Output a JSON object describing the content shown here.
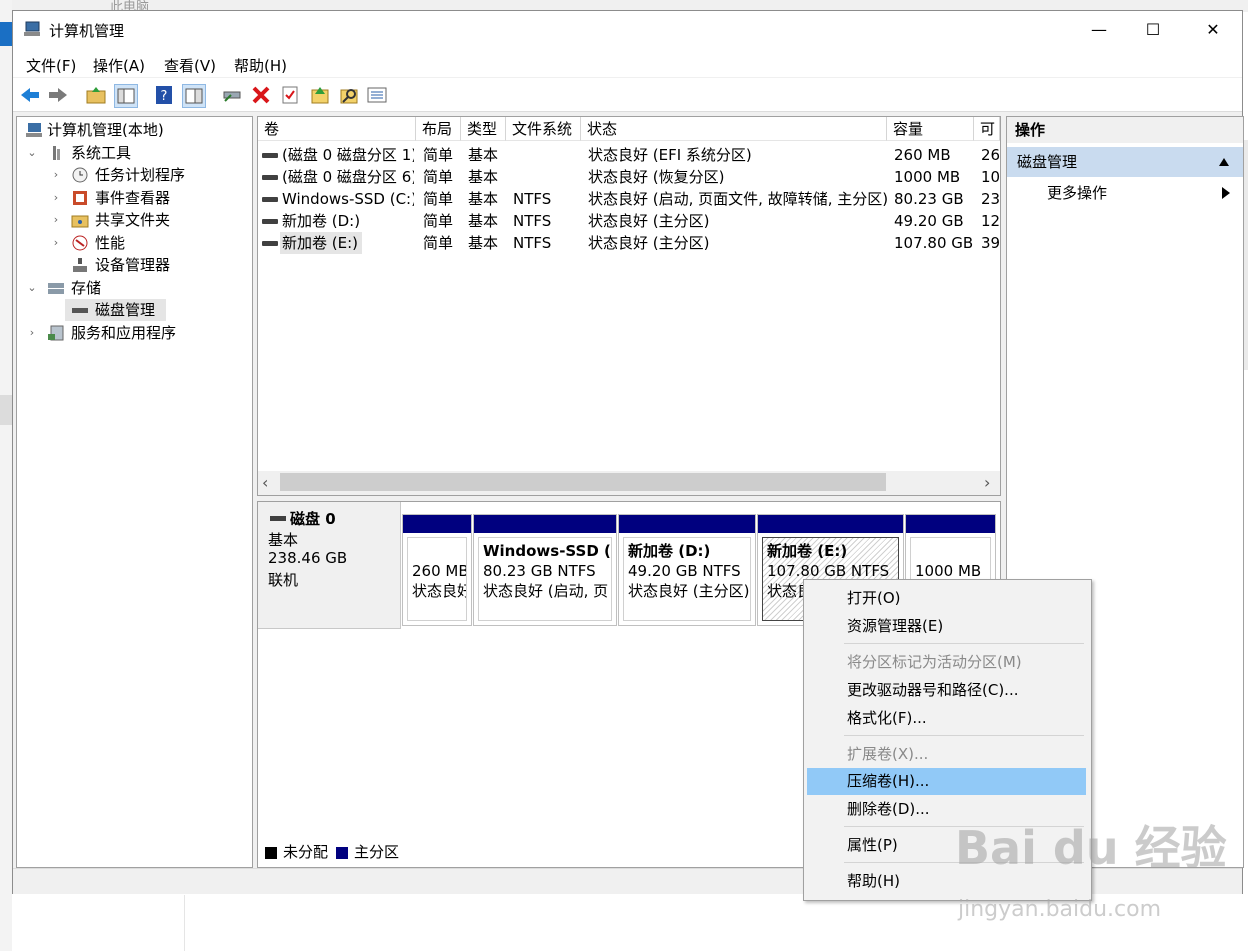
{
  "bg_tab_label": "此电脑",
  "window": {
    "title": "计算机管理",
    "minimize": "—",
    "maximize": "☐",
    "close": "✕"
  },
  "menu": [
    "文件(F)",
    "操作(A)",
    "查看(V)",
    "帮助(H)"
  ],
  "toolbar_icons": [
    "back-icon",
    "forward-icon",
    "up-folder-icon",
    "show-hide-tree-icon",
    "help-icon",
    "properties-view-icon",
    "connect-icon",
    "delete-icon",
    "check-icon",
    "import-icon",
    "search-icon",
    "list-icon"
  ],
  "tree": {
    "root": "计算机管理(本地)",
    "system_tools": "系统工具",
    "task_scheduler": "任务计划程序",
    "event_viewer": "事件查看器",
    "shared_folders": "共享文件夹",
    "performance": "性能",
    "device_manager": "设备管理器",
    "storage": "存储",
    "disk_management": "磁盘管理",
    "services": "服务和应用程序"
  },
  "volumes": {
    "columns": [
      "卷",
      "布局",
      "类型",
      "文件系统",
      "状态",
      "容量",
      "可"
    ],
    "rows": [
      [
        "(磁盘 0 磁盘分区 1)",
        "简单",
        "基本",
        "",
        "状态良好 (EFI 系统分区)",
        "260 MB",
        "26"
      ],
      [
        "(磁盘 0 磁盘分区 6)",
        "简单",
        "基本",
        "",
        "状态良好 (恢复分区)",
        "1000 MB",
        "10"
      ],
      [
        "Windows-SSD (C:)",
        "简单",
        "基本",
        "NTFS",
        "状态良好 (启动, 页面文件, 故障转储, 主分区)",
        "80.23 GB",
        "23"
      ],
      [
        "新加卷 (D:)",
        "简单",
        "基本",
        "NTFS",
        "状态良好 (主分区)",
        "49.20 GB",
        "12"
      ],
      [
        "新加卷 (E:)",
        "简单",
        "基本",
        "NTFS",
        "状态良好 (主分区)",
        "107.80 GB",
        "39"
      ]
    ],
    "scroll_left": "‹",
    "scroll_right": "›"
  },
  "disk": {
    "name": "磁盘 0",
    "type": "基本",
    "size": "238.46 GB",
    "status": "联机",
    "partitions": [
      {
        "title": "",
        "line1": "260 MB",
        "line2": "状态良好"
      },
      {
        "title": "Windows-SSD (C",
        "line1": "80.23 GB NTFS",
        "line2": "状态良好 (启动, 页"
      },
      {
        "title": "新加卷 (D:)",
        "line1": "49.20 GB NTFS",
        "line2": "状态良好 (主分区)"
      },
      {
        "title": "新加卷 (E:)",
        "line1": "107.80 GB NTFS",
        "line2": "状态良"
      },
      {
        "title": "",
        "line1": "1000 MB",
        "line2": ""
      }
    ],
    "legend": {
      "unallocated": "未分配",
      "primary": "主分区"
    }
  },
  "actions": {
    "header": "操作",
    "section": "磁盘管理",
    "more": "更多操作"
  },
  "context_menu": {
    "open": "打开(O)",
    "explorer": "资源管理器(E)",
    "mark_active": "将分区标记为活动分区(M)",
    "change_letter": "更改驱动器号和路径(C)...",
    "format": "格式化(F)...",
    "extend": "扩展卷(X)...",
    "shrink": "压缩卷(H)...",
    "delete": "删除卷(D)...",
    "properties": "属性(P)",
    "help": "帮助(H)"
  },
  "watermark": {
    "logo": "Bai du 经验",
    "url": "jingyan.baidu.com"
  },
  "colors": {
    "partition_bar": "#00007f",
    "highlight": "#91c9f7",
    "action_section": "#c9dbef",
    "delete_icon": "#d9161a",
    "back_icon": "#1e7fd6"
  }
}
